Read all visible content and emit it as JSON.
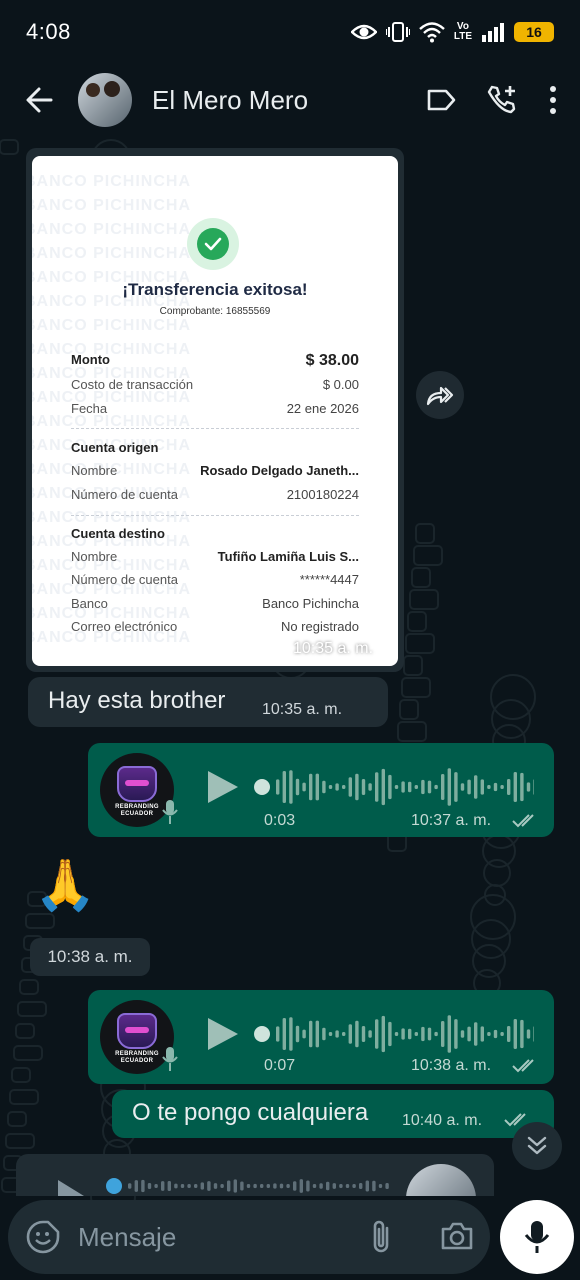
{
  "status_bar": {
    "time": "4:08",
    "network_top": "Vo",
    "network_bottom": "LTE",
    "battery": "16"
  },
  "header": {
    "contact_name": "El Mero Mero"
  },
  "receipt": {
    "watermark": "BANCO PICHINCHA",
    "title": "¡Transferencia exitosa!",
    "comprobante": "Comprobante: 16855569",
    "monto_label": "Monto",
    "monto_value": "$ 38.00",
    "costo_label": "Costo de transacción",
    "costo_value": "$ 0.00",
    "fecha_label": "Fecha",
    "fecha_value": "22 ene 2026",
    "origen_title": "Cuenta origen",
    "origen_nombre_label": "Nombre",
    "origen_nombre_value": "Rosado Delgado Janeth...",
    "origen_cuenta_label": "Número de cuenta",
    "origen_cuenta_value": "2100180224",
    "destino_title": "Cuenta destino",
    "destino_nombre_label": "Nombre",
    "destino_nombre_value": "Tufiño  Lamiña Luis S...",
    "destino_cuenta_label": "Número de cuenta",
    "destino_cuenta_value": "******4447",
    "banco_label": "Banco",
    "banco_value": "Banco Pichincha",
    "correo_label": "Correo electrónico",
    "correo_value": "No registrado",
    "time": "10:35 a. m."
  },
  "messages": {
    "m1_text": "Hay esta brother",
    "m1_time": "10:35 a. m.",
    "vn1_duration": "0:03",
    "vn1_time": "10:37 a. m.",
    "emoji": "🙏",
    "emoji_time": "10:38 a. m.",
    "vn2_duration": "0:07",
    "vn2_time": "10:38 a. m.",
    "m2_text": "O te pongo cualquiera",
    "m2_time": "10:40 a. m."
  },
  "voice_avatar": {
    "line1": "REBRANDING",
    "line2": "ECUADOR"
  },
  "composer": {
    "placeholder": "Mensaje"
  },
  "colors": {
    "outgoing": "#005c4b",
    "incoming": "#202c33",
    "background": "#0b141a",
    "read_tick": "#a8c9c1"
  }
}
